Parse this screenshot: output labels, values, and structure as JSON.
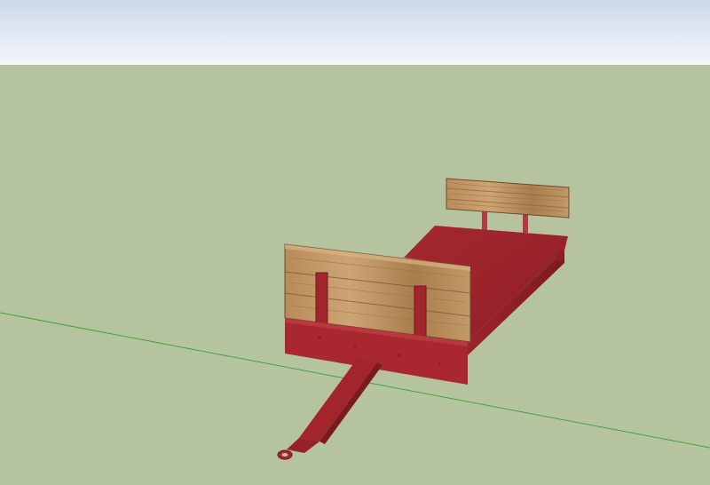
{
  "scene": {
    "colors": {
      "sky_top": "#cbd8ea",
      "sky_bottom": "#f4f7fb",
      "ground": "#b6c39f",
      "axis_green": "#3fa53a",
      "metal_red": "#a3252c",
      "metal_red_dark": "#7a1a21",
      "metal_red_light": "#b93a40",
      "wood_light": "#c49a66",
      "wood_mid": "#a77c4e",
      "wood_dark": "#7f5a34"
    },
    "model": {
      "name": "wagon",
      "parts": [
        "deck",
        "front-board",
        "back-board",
        "tongue",
        "hitch-ring"
      ]
    }
  }
}
